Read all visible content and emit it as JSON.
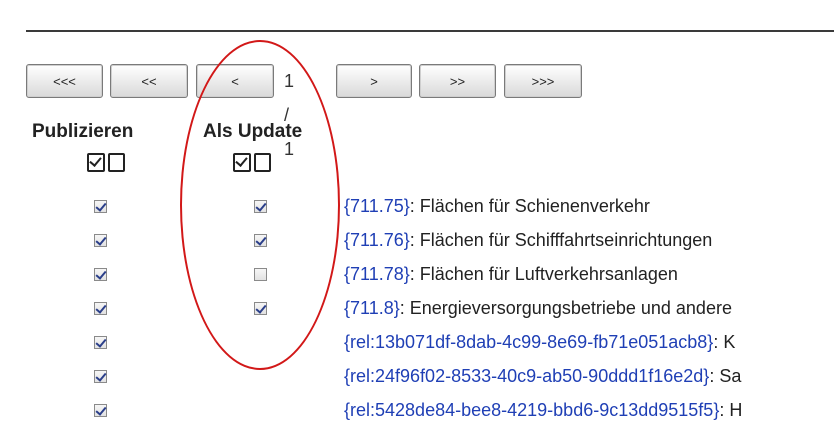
{
  "pager": {
    "first_label": "<<<",
    "prev_block_label": "<<",
    "prev_label": "<",
    "page_indicator": "1 / 1",
    "next_label": ">",
    "next_block_label": ">>",
    "last_label": ">>>"
  },
  "columns": {
    "publish_header": "Publizieren",
    "update_header": "Als Update"
  },
  "bulk_icons": [
    "select-all-icon",
    "select-none-icon"
  ],
  "rows": [
    {
      "key": "{711.75}",
      "label": ": Flächen für Schienenverkehr",
      "publish": true,
      "update": true
    },
    {
      "key": "{711.76}",
      "label": ": Flächen für Schifffahrtseinrichtungen",
      "publish": true,
      "update": true
    },
    {
      "key": "{711.78}",
      "label": ": Flächen für Luftverkehrsanlagen",
      "publish": true,
      "update": false
    },
    {
      "key": "{711.8}",
      "label": ": Energieversorgungsbetriebe und andere",
      "publish": true,
      "update": true
    },
    {
      "key": "{rel:13b071df-8dab-4c99-8e69-fb71e051acb8}",
      "label": ": K",
      "publish": true,
      "update": null
    },
    {
      "key": "{rel:24f96f02-8533-40c9-ab50-90ddd1f16e2d}",
      "label": ": Sa",
      "publish": true,
      "update": null
    },
    {
      "key": "{rel:5428de84-bee8-4219-bbd6-9c13dd9515f5}",
      "label": ": H",
      "publish": true,
      "update": null
    }
  ],
  "colors": {
    "key_link": "#1f3fb5",
    "annotation_ellipse": "#d21818"
  }
}
